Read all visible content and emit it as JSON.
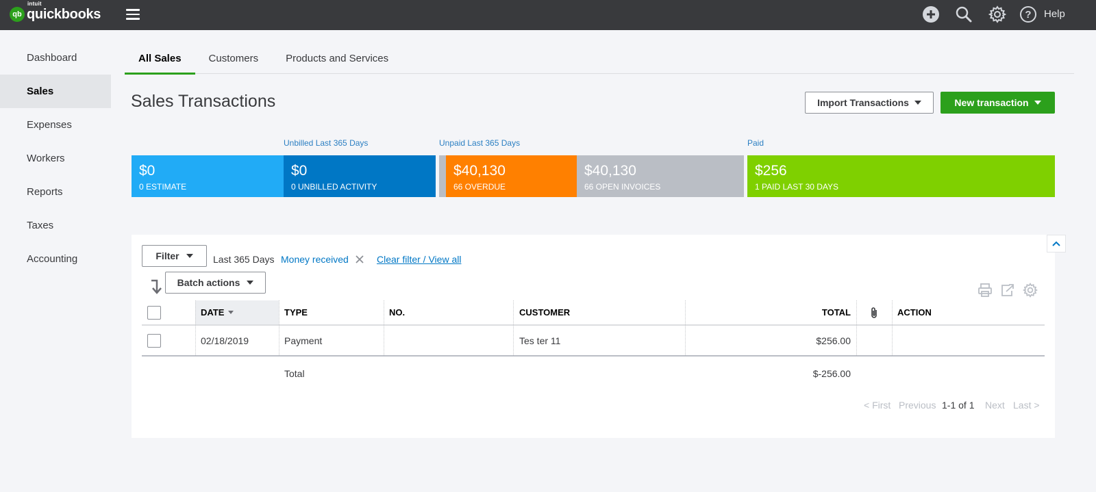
{
  "brand": {
    "intuit": "intuit",
    "name": "quickbooks",
    "badge": "qb"
  },
  "topbar": {
    "help_label": "Help"
  },
  "sidebar": {
    "items": [
      {
        "label": "Dashboard",
        "active": false
      },
      {
        "label": "Sales",
        "active": true
      },
      {
        "label": "Expenses",
        "active": false
      },
      {
        "label": "Workers",
        "active": false
      },
      {
        "label": "Reports",
        "active": false
      },
      {
        "label": "Taxes",
        "active": false
      },
      {
        "label": "Accounting",
        "active": false
      }
    ]
  },
  "tabs": [
    {
      "label": "All Sales",
      "active": true
    },
    {
      "label": "Customers",
      "active": false
    },
    {
      "label": "Products and Services",
      "active": false
    }
  ],
  "page": {
    "title": "Sales Transactions",
    "import_button": "Import Transactions",
    "new_button": "New transaction"
  },
  "money_bar": {
    "labels": {
      "unbilled": "Unbilled Last 365 Days",
      "unpaid": "Unpaid Last 365 Days",
      "paid": "Paid"
    },
    "segments": [
      {
        "amount": "$0",
        "caption": "0 ESTIMATE",
        "color": "#21abf6"
      },
      {
        "amount": "$0",
        "caption": "0 UNBILLED ACTIVITY",
        "color": "#0077c5"
      },
      {
        "amount": "$40,130",
        "caption": "66 OVERDUE",
        "color": "#ff8000"
      },
      {
        "amount": "$40,130",
        "caption": "66 OPEN INVOICES",
        "color": "#babec5"
      },
      {
        "amount": "$256",
        "caption": "1 PAID LAST 30 DAYS",
        "color": "#7fd000"
      }
    ]
  },
  "filters": {
    "filter_button": "Filter",
    "date_range": "Last 365 Days",
    "status": "Money received",
    "clear_link": "Clear filter / View all",
    "batch_button": "Batch actions"
  },
  "table": {
    "columns": {
      "date": "DATE",
      "type": "TYPE",
      "no": "NO.",
      "customer": "CUSTOMER",
      "total": "TOTAL",
      "action": "ACTION"
    },
    "rows": [
      {
        "date": "02/18/2019",
        "type": "Payment",
        "no": "",
        "customer": "Tes ter 11",
        "total": "$256.00",
        "action": ""
      }
    ],
    "footer": {
      "label": "Total",
      "value": "$-256.00"
    }
  },
  "pagination": {
    "first": "< First",
    "previous": "Previous",
    "range": "1-1 of 1",
    "next": "Next",
    "last": "Last >"
  },
  "colors": {
    "topbar": "#393a3d",
    "accent_green": "#2ca01c",
    "link_blue": "#0077c5"
  }
}
